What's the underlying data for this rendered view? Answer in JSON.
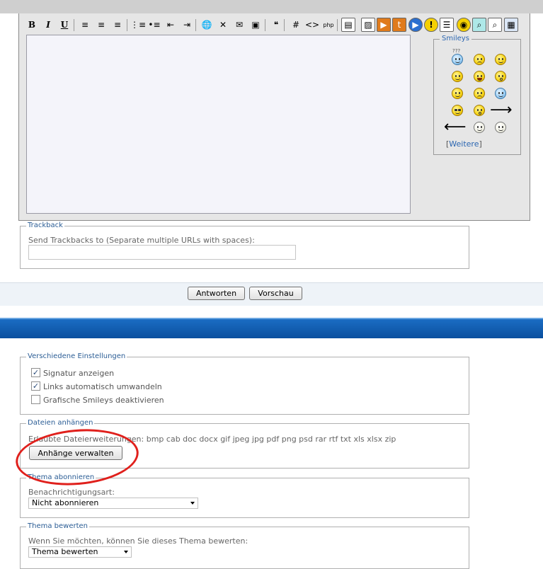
{
  "toolbar": {
    "items": [
      {
        "name": "bold-button",
        "glyph": "B"
      },
      {
        "name": "italic-button",
        "glyph": "I"
      },
      {
        "name": "underline-button",
        "glyph": "U"
      },
      {
        "name": "align-left-icon",
        "glyph": "≡"
      },
      {
        "name": "align-center-icon",
        "glyph": "≡"
      },
      {
        "name": "align-right-icon",
        "glyph": "≡"
      },
      {
        "name": "ordered-list-icon",
        "glyph": "⋮≡"
      },
      {
        "name": "unordered-list-icon",
        "glyph": "•≡"
      },
      {
        "name": "outdent-icon",
        "glyph": "⇤"
      },
      {
        "name": "indent-icon",
        "glyph": "⇥"
      },
      {
        "name": "link-icon",
        "glyph": "🌐"
      },
      {
        "name": "unlink-icon",
        "glyph": "✕"
      },
      {
        "name": "email-icon",
        "glyph": "✉"
      },
      {
        "name": "image-icon",
        "glyph": "▣"
      },
      {
        "name": "quote-icon",
        "glyph": "❝"
      },
      {
        "name": "code-hash-icon",
        "glyph": "#"
      },
      {
        "name": "html-code-icon",
        "glyph": "<>"
      },
      {
        "name": "php-code-icon",
        "glyph": "php"
      },
      {
        "name": "powerpoint-icon",
        "glyph": "▤"
      },
      {
        "name": "image-upload-icon",
        "glyph": "▨"
      },
      {
        "name": "youtube-icon",
        "glyph": "▶"
      },
      {
        "name": "tuw-icon",
        "glyph": "t"
      },
      {
        "name": "video-play-icon",
        "glyph": "▶"
      },
      {
        "name": "warning-icon",
        "glyph": "!"
      },
      {
        "name": "list-lines-icon",
        "glyph": "☰"
      },
      {
        "name": "spoiler-icon",
        "glyph": "◉"
      },
      {
        "name": "search-icon",
        "glyph": "⌕"
      },
      {
        "name": "search-gray-icon",
        "glyph": "⌕"
      },
      {
        "name": "table-icon",
        "glyph": "▦"
      }
    ]
  },
  "smileys": {
    "legend": "Smileys",
    "more_link": "Weitere",
    "question_mark_text": "???"
  },
  "trackback": {
    "legend": "Trackback",
    "label": "Send Trackbacks to (Separate multiple URLs with spaces):",
    "value": ""
  },
  "buttons": {
    "reply": "Antworten",
    "preview": "Vorschau"
  },
  "misc": {
    "legend": "Verschiedene Einstellungen",
    "options": [
      {
        "label": "Signatur anzeigen",
        "checked": true
      },
      {
        "label": "Links automatisch umwandeln",
        "checked": true
      },
      {
        "label": "Grafische Smileys deaktivieren",
        "checked": false
      }
    ]
  },
  "attachments": {
    "legend": "Dateien anhängen",
    "allowed_text": "Erlaubte Dateierweiterungen: bmp cab doc docx gif jpeg jpg pdf png psd rar rtf txt xls xlsx zip",
    "manage_button": "Anhänge verwalten"
  },
  "subscribe": {
    "legend": "Thema abonnieren",
    "label": "Benachrichtigungsart:",
    "selected": "Nicht abonnieren"
  },
  "rate": {
    "legend": "Thema bewerten",
    "label": "Wenn Sie möchten, können Sie dieses Thema bewerten:",
    "selected": "Thema bewerten"
  },
  "colors": {
    "accent_blue": "#1c6fc6",
    "highlight_red": "#e0201c"
  }
}
